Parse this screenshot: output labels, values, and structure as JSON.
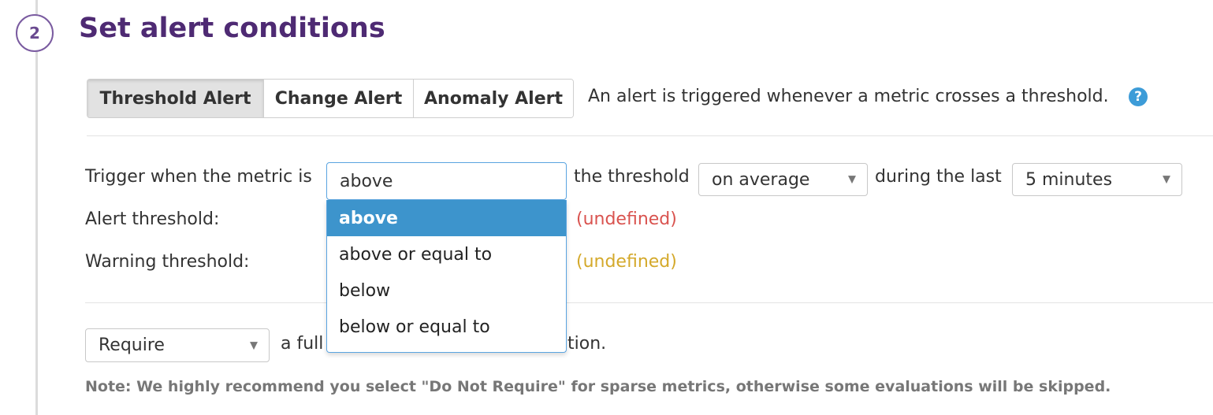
{
  "step": {
    "number": "2",
    "title": "Set alert conditions"
  },
  "tabs": [
    {
      "label": "Threshold Alert",
      "active": true
    },
    {
      "label": "Change Alert",
      "active": false
    },
    {
      "label": "Anomaly Alert",
      "active": false
    }
  ],
  "description": "An alert is triggered whenever a metric crosses a threshold.",
  "help_icon": "?",
  "trigger": {
    "prefix": "Trigger when the metric is",
    "comparison_value": "above",
    "middle": "the threshold",
    "aggregation_value": "on average",
    "during": "during the last",
    "window_value": "5 minutes"
  },
  "dropdown_options": [
    {
      "label": "above",
      "selected": true
    },
    {
      "label": "above or equal to",
      "selected": false
    },
    {
      "label": "below",
      "selected": false
    },
    {
      "label": "below or equal to",
      "selected": false
    }
  ],
  "alert_threshold": {
    "label": "Alert threshold:",
    "status": "(undefined)"
  },
  "warning_threshold": {
    "label": "Warning threshold:",
    "status": "(undefined)"
  },
  "require": {
    "value": "Require",
    "text_before": "a full",
    "text_after": "tion."
  },
  "note": "Note: We highly recommend you select \"Do Not Require\" for sparse metrics, otherwise some evaluations will be skipped.",
  "colors": {
    "title": "#4e2a73",
    "accent": "#3d94cc",
    "alert": "#d9534f",
    "warning": "#d4a92b"
  }
}
